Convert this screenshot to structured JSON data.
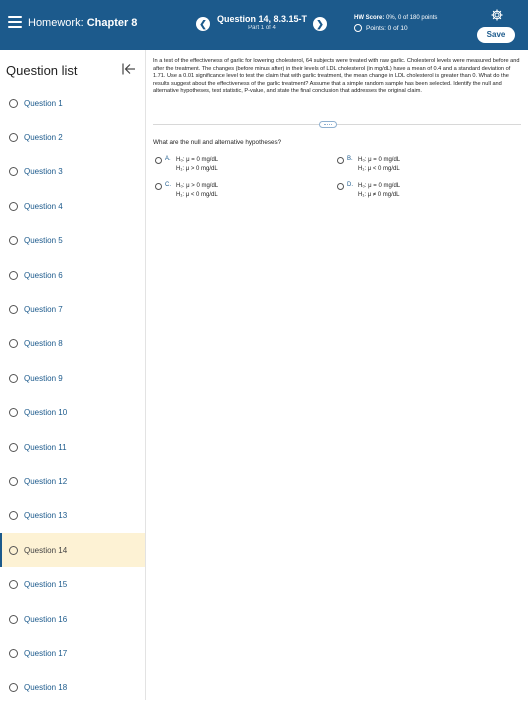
{
  "header": {
    "assignment_label": "Homework:",
    "assignment_name": "Chapter 8",
    "question_title": "Question 14, 8.3.15-T",
    "part": "Part 1 of 4",
    "hw_score_label": "HW Score:",
    "hw_score_value": "0%, 0 of 180 points",
    "points": "Points: 0 of 10",
    "save_label": "Save"
  },
  "sidebar": {
    "title": "Question list",
    "items": [
      {
        "label": "Question 1"
      },
      {
        "label": "Question 2"
      },
      {
        "label": "Question 3"
      },
      {
        "label": "Question 4"
      },
      {
        "label": "Question 5"
      },
      {
        "label": "Question 6"
      },
      {
        "label": "Question 7"
      },
      {
        "label": "Question 8"
      },
      {
        "label": "Question 9"
      },
      {
        "label": "Question 10"
      },
      {
        "label": "Question 11"
      },
      {
        "label": "Question 12"
      },
      {
        "label": "Question 13"
      },
      {
        "label": "Question 14"
      },
      {
        "label": "Question 15"
      },
      {
        "label": "Question 16"
      },
      {
        "label": "Question 17"
      },
      {
        "label": "Question 18"
      }
    ],
    "active_index": 13
  },
  "question": {
    "problem_text": "In a test of the effectiveness of garlic for lowering cholesterol, 64 subjects were treated with raw garlic. Cholesterol levels were measured before and after the treatment. The changes (before minus after) in their levels of LDL cholesterol (in mg/dL) have a mean of 0.4 and a standard deviation of 1.71. Use a 0.01 significance level to test the claim that with garlic treatment, the mean change in LDL cholesterol is greater than 0. What do the results suggest about the effectiveness of the garlic treatment? Assume that a simple random sample has been selected. Identify the null and alternative hypotheses, test statistic, P-value, and state the final conclusion that addresses the original claim.",
    "prompt": "What are the null and alternative hypotheses?",
    "options": [
      {
        "letter": "A.",
        "h0": "H₀: μ = 0 mg/dL",
        "h1": "H₁: μ > 0 mg/dL"
      },
      {
        "letter": "B.",
        "h0": "H₀: μ = 0 mg/dL",
        "h1": "H₁: μ < 0 mg/dL"
      },
      {
        "letter": "C.",
        "h0": "H₀: μ > 0 mg/dL",
        "h1": "H₁: μ < 0 mg/dL"
      },
      {
        "letter": "D.",
        "h0": "H₀: μ = 0 mg/dL",
        "h1": "H₁: μ ≠ 0 mg/dL"
      }
    ]
  },
  "colors": {
    "header_bg": "#1c5a8c",
    "active_item_bg": "#fdf2d4",
    "link": "#1c5a8c"
  },
  "icons": {
    "menu": "menu-icon",
    "prev": "chevron-left-icon",
    "next": "chevron-right-icon",
    "settings": "gear-icon",
    "collapse": "collapse-sidebar-icon"
  }
}
